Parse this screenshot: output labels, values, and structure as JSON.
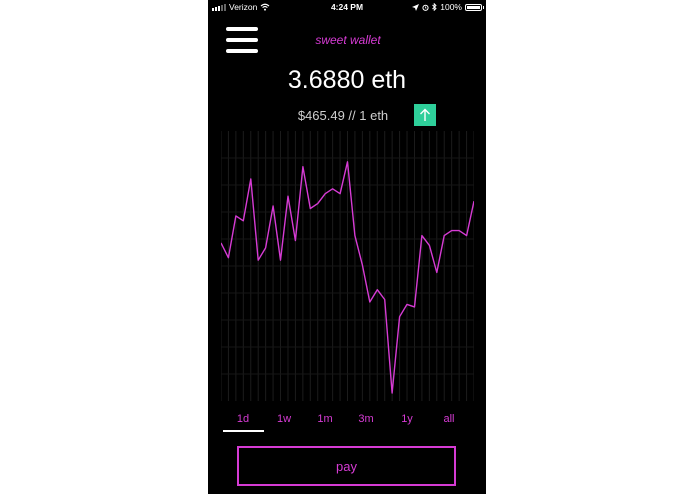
{
  "status_bar": {
    "carrier": "Verizon",
    "time": "4:24 PM",
    "battery": "100%"
  },
  "header": {
    "app_title": "sweet wallet",
    "menu_icon": "hamburger-menu-icon"
  },
  "balance": {
    "amount": "3.6880 eth"
  },
  "price": {
    "text": "$465.49 // 1 eth",
    "trend_icon": "arrow-up-icon",
    "trend_color": "#2ecf9a"
  },
  "chart_data": {
    "type": "line",
    "line_color": "#d63bd4",
    "grid": true,
    "values": [
      0.61,
      0.55,
      0.72,
      0.7,
      0.87,
      0.54,
      0.59,
      0.76,
      0.54,
      0.8,
      0.62,
      0.92,
      0.75,
      0.77,
      0.81,
      0.83,
      0.81,
      0.94,
      0.64,
      0.52,
      0.37,
      0.42,
      0.38,
      0.0,
      0.31,
      0.36,
      0.35,
      0.64,
      0.6,
      0.49,
      0.64,
      0.66,
      0.66,
      0.64,
      0.78
    ]
  },
  "ranges": {
    "items": [
      {
        "label": "1d"
      },
      {
        "label": "1w"
      },
      {
        "label": "1m"
      },
      {
        "label": "3m"
      },
      {
        "label": "1y"
      },
      {
        "label": "all"
      }
    ],
    "selected": "1d"
  },
  "actions": {
    "pay_label": "pay"
  },
  "colors": {
    "accent": "#d63bd4",
    "background": "#000000",
    "positive": "#2ecf9a"
  }
}
